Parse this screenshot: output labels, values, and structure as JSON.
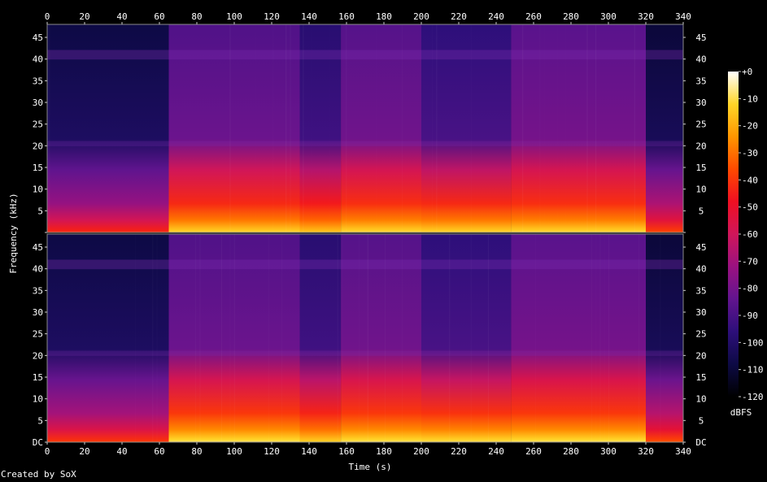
{
  "chart_data": {
    "type": "heatmap",
    "tool_credit": "Created by SoX",
    "xlabel": "Time (s)",
    "ylabel": "Frequency (kHz)",
    "colorbar_label": "dBFS",
    "xlim": [
      0,
      340
    ],
    "ylim": [
      0,
      48
    ],
    "x_ticks": [
      0,
      20,
      40,
      60,
      80,
      100,
      120,
      140,
      160,
      180,
      200,
      220,
      240,
      260,
      280,
      300,
      320,
      340
    ],
    "y_tick_values": [
      0,
      5,
      10,
      15,
      20,
      25,
      30,
      35,
      40,
      45
    ],
    "y_tick_labels": [
      "DC",
      "5",
      "10",
      "15",
      "20",
      "25",
      "30",
      "35",
      "40",
      "45"
    ],
    "colorbar_range": [
      -120,
      0
    ],
    "colorbar_ticks": [
      "+0",
      "-10",
      "-20",
      "-30",
      "-40",
      "-50",
      "-60",
      "-70",
      "-80",
      "-90",
      "-100",
      "-110",
      "-120"
    ],
    "channels": [
      {
        "segments": [
          {
            "t": [
              0,
              65
            ],
            "floor_db": -108,
            "low_db": -45
          },
          {
            "t": [
              65,
              135
            ],
            "floor_db": -88,
            "low_db": -15
          },
          {
            "t": [
              135,
              157
            ],
            "floor_db": -98,
            "low_db": -18
          },
          {
            "t": [
              157,
              200
            ],
            "floor_db": -87,
            "low_db": -14
          },
          {
            "t": [
              200,
              248
            ],
            "floor_db": -96,
            "low_db": -15
          },
          {
            "t": [
              248,
              320
            ],
            "floor_db": -86,
            "low_db": -14
          },
          {
            "t": [
              320,
              340
            ],
            "floor_db": -110,
            "low_db": -40
          }
        ]
      },
      {
        "segments": [
          {
            "t": [
              0,
              65
            ],
            "floor_db": -108,
            "low_db": -42
          },
          {
            "t": [
              65,
              135
            ],
            "floor_db": -88,
            "low_db": -12
          },
          {
            "t": [
              135,
              157
            ],
            "floor_db": -98,
            "low_db": -16
          },
          {
            "t": [
              157,
              200
            ],
            "floor_db": -87,
            "low_db": -12
          },
          {
            "t": [
              200,
              248
            ],
            "floor_db": -96,
            "low_db": -13
          },
          {
            "t": [
              248,
              320
            ],
            "floor_db": -86,
            "low_db": -12
          },
          {
            "t": [
              320,
              340
            ],
            "floor_db": -110,
            "low_db": -38
          }
        ]
      }
    ],
    "colormap_stops": [
      {
        "db": -120,
        "color": "#000000"
      },
      {
        "db": -108,
        "color": "#0d0a45"
      },
      {
        "db": -96,
        "color": "#2d0f7a"
      },
      {
        "db": -84,
        "color": "#62148f"
      },
      {
        "db": -72,
        "color": "#9a1280"
      },
      {
        "db": -60,
        "color": "#d0165a"
      },
      {
        "db": -48,
        "color": "#f00f22"
      },
      {
        "db": -36,
        "color": "#ff4a00"
      },
      {
        "db": -24,
        "color": "#ff9600"
      },
      {
        "db": -12,
        "color": "#ffd628"
      },
      {
        "db": 0,
        "color": "#ffffff"
      }
    ]
  }
}
